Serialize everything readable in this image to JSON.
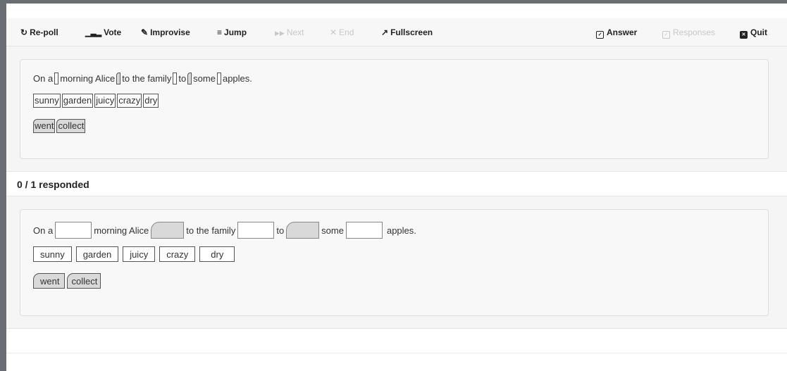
{
  "toolbar": {
    "repoll": {
      "icon": "refresh-icon",
      "label": "Re-poll",
      "enabled": true
    },
    "vote": {
      "icon": "bar-chart-icon",
      "label": "Vote",
      "enabled": true
    },
    "improvise": {
      "icon": "edit-icon",
      "label": "Improvise",
      "enabled": true
    },
    "jump": {
      "icon": "list-icon",
      "label": "Jump",
      "enabled": true
    },
    "next": {
      "icon": "forward-icon",
      "label": "Next",
      "enabled": false
    },
    "end": {
      "icon": "close-icon",
      "label": "End",
      "enabled": false
    },
    "fullscreen": {
      "icon": "expand-icon",
      "label": "Fullscreen",
      "enabled": true
    },
    "answer": {
      "icon": "checkbox-icon",
      "label": "Answer",
      "enabled": true
    },
    "responses": {
      "icon": "checkbox-icon",
      "label": "Responses",
      "enabled": false
    },
    "quit": {
      "icon": "close-square-icon",
      "label": "Quit",
      "enabled": true
    }
  },
  "question": {
    "sentence": [
      "On a",
      "morning Alice",
      "to the family",
      "to",
      "some",
      "apples."
    ],
    "adjectives": [
      "sunny",
      "garden",
      "juicy",
      "crazy",
      "dry"
    ],
    "verbs": [
      "went",
      "collect"
    ]
  },
  "responded": "0 / 1 responded",
  "colors": {
    "frame": "#6a6e73",
    "toolbar_bg": "#f7f7f7",
    "panel_bg": "#f5f5f5",
    "verb_chip": "#d9d9d9",
    "disabled": "#c8c8c8"
  }
}
